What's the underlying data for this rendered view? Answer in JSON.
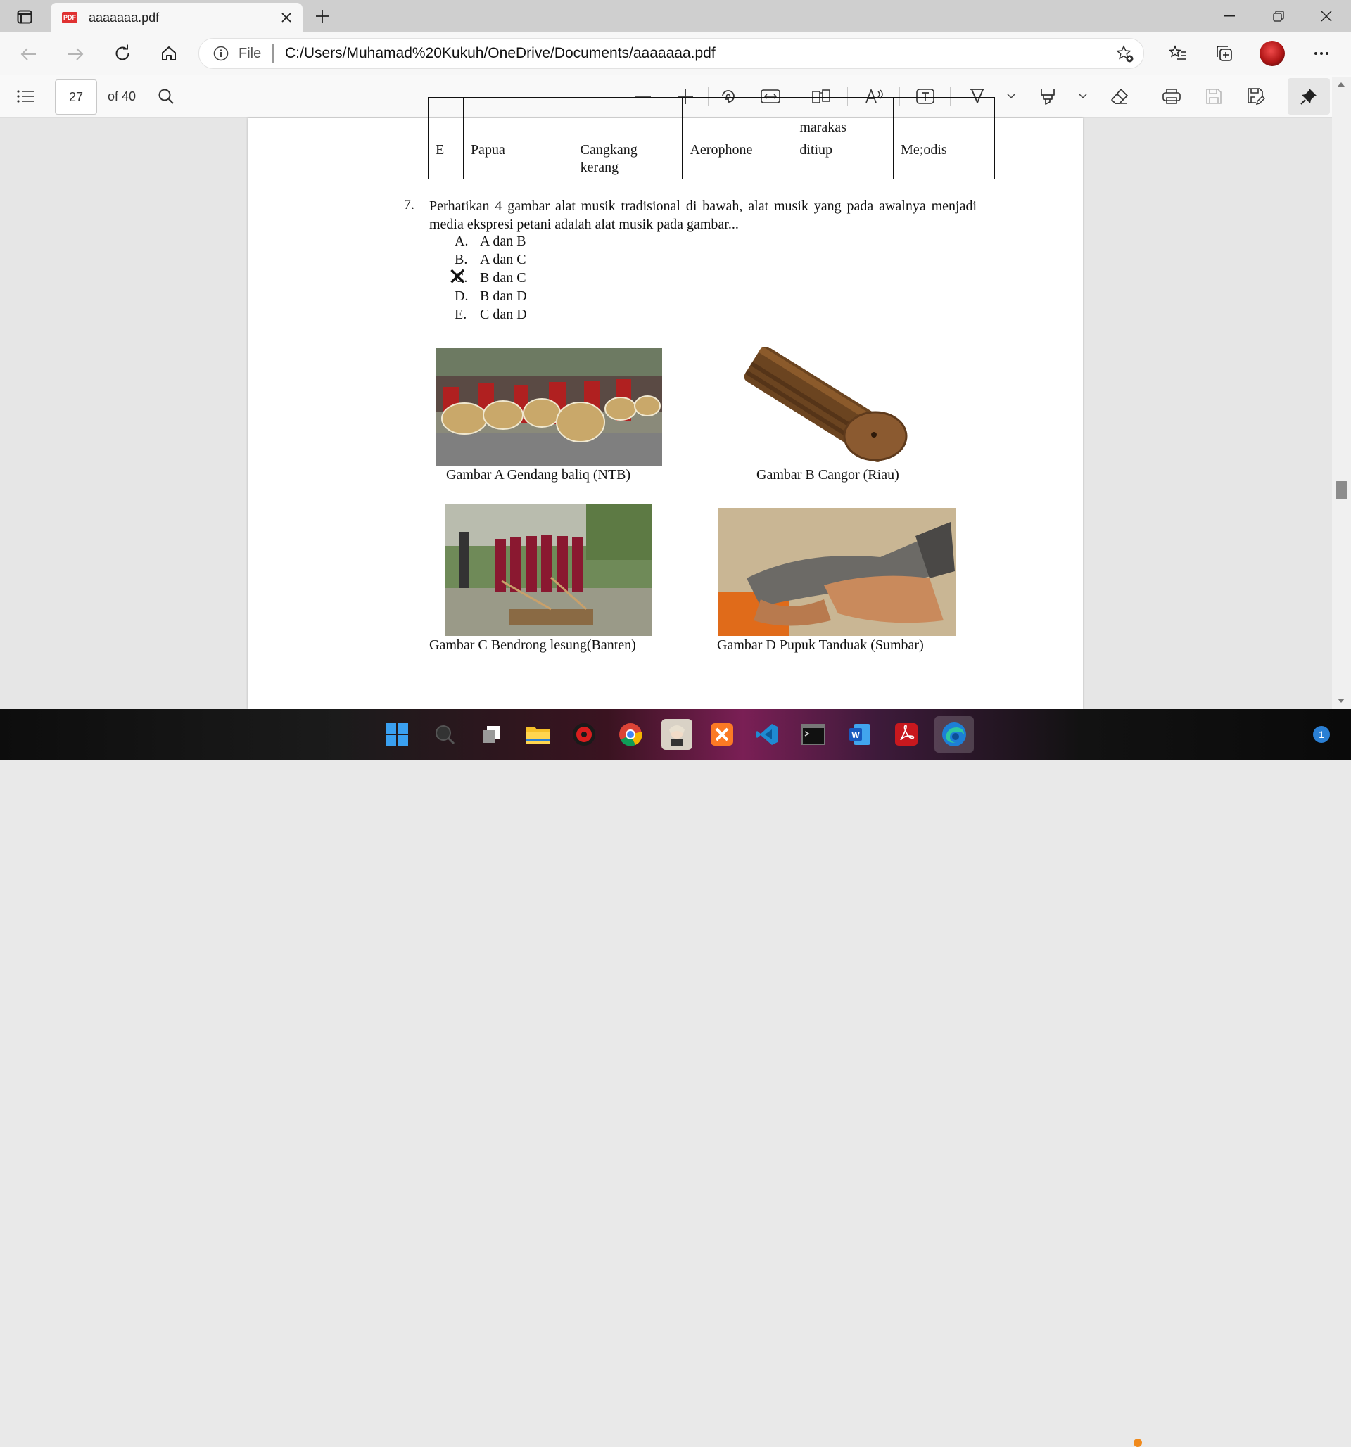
{
  "browser": {
    "tab_title": "aaaaaaa.pdf",
    "pdf_badge": "PDF",
    "address_scheme": "File",
    "address_url": "C:/Users/Muhamad%20Kukuh/OneDrive/Documents/aaaaaaa.pdf"
  },
  "pdf_toolbar": {
    "page_number": "27",
    "page_total": "of 40"
  },
  "table_rows": [
    {
      "c1": "",
      "c2": "",
      "c3": "",
      "c4": "",
      "c5": "marakas",
      "c6": ""
    },
    {
      "c1": "E",
      "c2": "Papua",
      "c3": "Cangkang kerang",
      "c4": "Aerophone",
      "c5": "ditiup",
      "c6": "Me;odis"
    }
  ],
  "question": {
    "number": "7.",
    "text": "Perhatikan 4 gambar alat musik tradisional di bawah, alat musik yang pada awalnya menjadi media ekspresi petani adalah alat musik pada gambar...",
    "options": [
      {
        "letter": "A.",
        "text": "A dan B"
      },
      {
        "letter": "B.",
        "text": "A dan C"
      },
      {
        "letter": "C.",
        "text": "B dan C"
      },
      {
        "letter": "D.",
        "text": "B dan D"
      },
      {
        "letter": "E.",
        "text": "C dan D"
      }
    ],
    "selected_mark": "✕"
  },
  "figures": [
    {
      "caption": "Gambar A Gendang baliq (NTB)"
    },
    {
      "caption": "Gambar B Cangor (Riau)"
    },
    {
      "caption": "Gambar C Bendrong lesung(Banten)"
    },
    {
      "caption": "Gambar D Pupuk Tanduak (Sumbar)"
    }
  ],
  "taskbar": {
    "notification_count": "1"
  }
}
